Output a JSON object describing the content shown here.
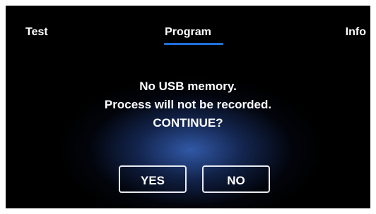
{
  "tabs": {
    "test": "Test",
    "program": "Program",
    "info": "Info"
  },
  "dialog": {
    "line1": "No USB memory.",
    "line2": "Process will not be recorded.",
    "line3": "CONTINUE?"
  },
  "buttons": {
    "yes": "YES",
    "no": "NO"
  },
  "colors": {
    "background": "#000000",
    "active_tab_underline": "#1e6fd9",
    "glow": "#3a68c4"
  },
  "active_tab": "program"
}
